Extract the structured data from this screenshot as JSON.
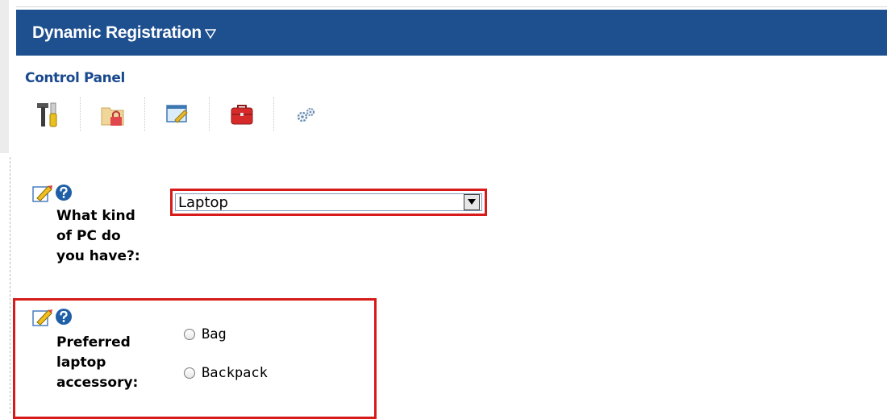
{
  "header": {
    "title": "Dynamic Registration"
  },
  "control_panel": {
    "label": "Control Panel",
    "tools": [
      {
        "icon": "tools-icon"
      },
      {
        "icon": "folder-lock-icon"
      },
      {
        "icon": "window-edit-icon"
      },
      {
        "icon": "toolbox-icon"
      },
      {
        "icon": "gears-icon"
      }
    ]
  },
  "questions": [
    {
      "label": "What kind of PC do you have?:",
      "label_lines": [
        "What kind",
        "of PC do",
        "you have?:"
      ],
      "type": "select",
      "value": "Laptop"
    },
    {
      "label": "Preferred laptop accessory:",
      "label_lines": [
        "Preferred",
        "laptop",
        "accessory:"
      ],
      "type": "radio",
      "options": [
        "Bag",
        "Backpack"
      ]
    }
  ],
  "colors": {
    "header_bg": "#1e4f8f",
    "highlight": "#d71b1b",
    "link_blue": "#1a4a8e"
  }
}
